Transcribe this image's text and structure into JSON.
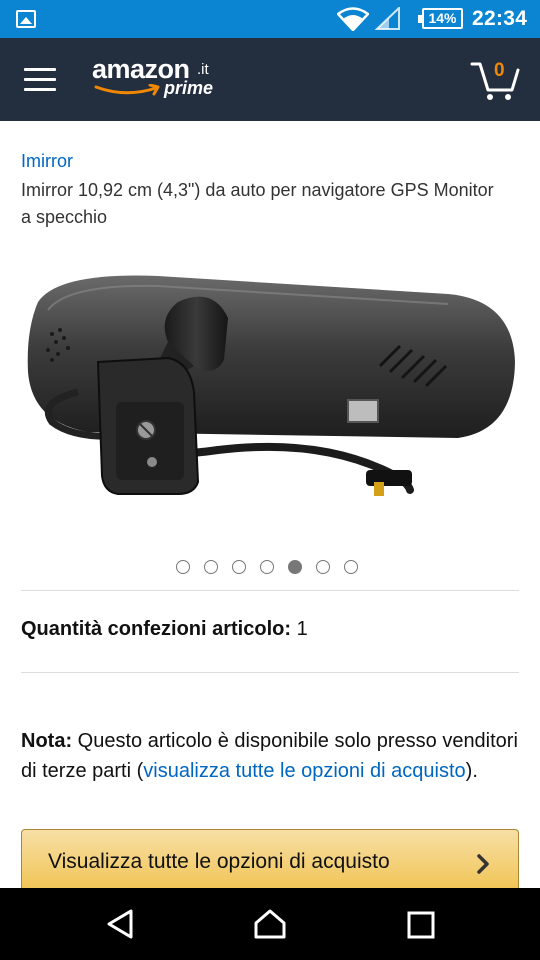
{
  "status_bar": {
    "battery": "14%",
    "time": "22:34",
    "icons": [
      "gallery-icon",
      "wifi-icon",
      "signal-icon",
      "battery-icon"
    ]
  },
  "header": {
    "logo_word": "amazon",
    "logo_tld": ".it",
    "logo_sub": "prime",
    "cart_count": "0",
    "colors": {
      "bar": "#232f3e",
      "smile": "#f08804"
    }
  },
  "product": {
    "brand": "Imirror",
    "title": "Imirror 10,92 cm (4,3\") da auto per navigatore GPS Monitor a specchio",
    "image": "rearview-mirror-monitor-photo",
    "carousel": {
      "total": 7,
      "active": 5
    }
  },
  "quantity": {
    "label": "Quantità confezioni articolo:",
    "value": "1"
  },
  "note": {
    "label": "Nota:",
    "text_before": " Questo articolo è disponibile solo presso venditori di terze parti (",
    "link": "visualizza tutte le opzioni di acquisto",
    "text_after": ")."
  },
  "cta": {
    "label": "Visualizza tutte le opzioni di acquisto",
    "colors": {
      "top": "#f7dfa5",
      "bottom": "#f0c14b",
      "border": "#a88734"
    }
  },
  "nav_bar": {
    "buttons": [
      "back-icon",
      "home-icon",
      "recents-icon"
    ]
  },
  "colors": {
    "status": "#0b85d1",
    "link": "#0066c0"
  }
}
